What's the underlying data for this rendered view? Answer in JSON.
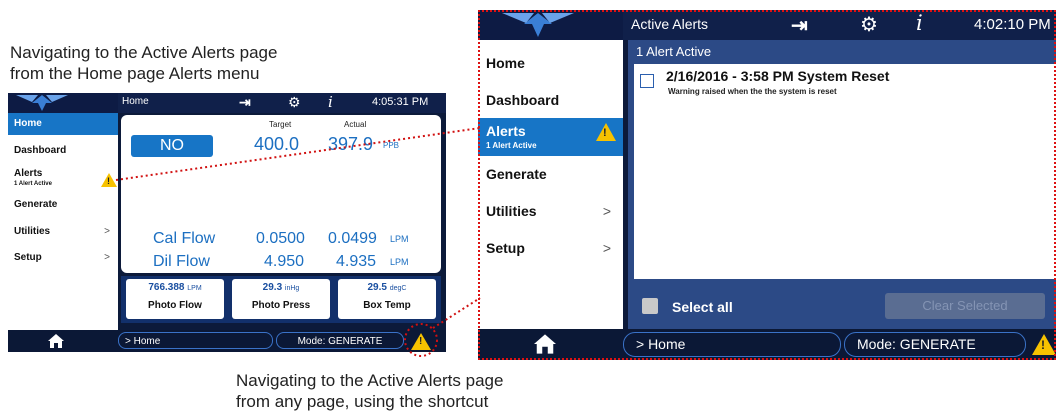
{
  "captions": {
    "top": "Navigating to the Active Alerts page\nfrom the Home page Alerts menu",
    "bottom": "Navigating to the Active Alerts page\nfrom any page, using the shortcut"
  },
  "colors": {
    "accent": "#1775c6",
    "warning": "#f7c200",
    "callout": "#d11111",
    "navy": "#0c1a3a"
  },
  "icons": [
    "logo-icon",
    "exit-icon",
    "gear-icon",
    "info-icon",
    "warning-icon",
    "home-icon",
    "chevron-right-icon",
    "checkbox-icon"
  ],
  "home_screen": {
    "title": "Home",
    "clock": "4:05:31 PM",
    "sidebar": {
      "home": "Home",
      "dashboard": "Dashboard",
      "alerts": "Alerts",
      "alerts_sub": "1 Alert Active",
      "generate": "Generate",
      "utilities": "Utilities",
      "setup": "Setup",
      "chevron": ">"
    },
    "main": {
      "gas": "NO",
      "target_header": "Target",
      "actual_header": "Actual",
      "target": "400.0",
      "actual": "397.9",
      "unit": "PPB",
      "rows": [
        {
          "label": "Cal Flow",
          "target": "0.0500",
          "actual": "0.0499",
          "unit": "LPM"
        },
        {
          "label": "Dil Flow",
          "target": "4.950",
          "actual": "4.935",
          "unit": "LPM"
        }
      ]
    },
    "tiles": [
      {
        "value": "766.388",
        "unit": "LPM",
        "name": "Photo Flow"
      },
      {
        "value": "29.3",
        "unit": "inHg",
        "name": "Photo Press"
      },
      {
        "value": "29.5",
        "unit": "degC",
        "name": "Box Temp"
      }
    ],
    "breadcrumb": "> Home",
    "mode": "Mode: GENERATE"
  },
  "alerts_screen": {
    "title": "Active Alerts",
    "clock": "4:02:10 PM",
    "sidebar": {
      "home": "Home",
      "dashboard": "Dashboard",
      "alerts": "Alerts",
      "alerts_sub": "1 Alert Active",
      "generate": "Generate",
      "utilities": "Utilities",
      "setup": "Setup",
      "chevron": ">"
    },
    "alert_count": "1 Alert Active",
    "alert": {
      "title": "2/16/2016 - 3:58 PM System Reset",
      "description": "Warning raised when the the system is reset"
    },
    "select_all": "Select all",
    "clear_selected": "Clear Selected",
    "breadcrumb": "> Home",
    "mode": "Mode: GENERATE"
  }
}
